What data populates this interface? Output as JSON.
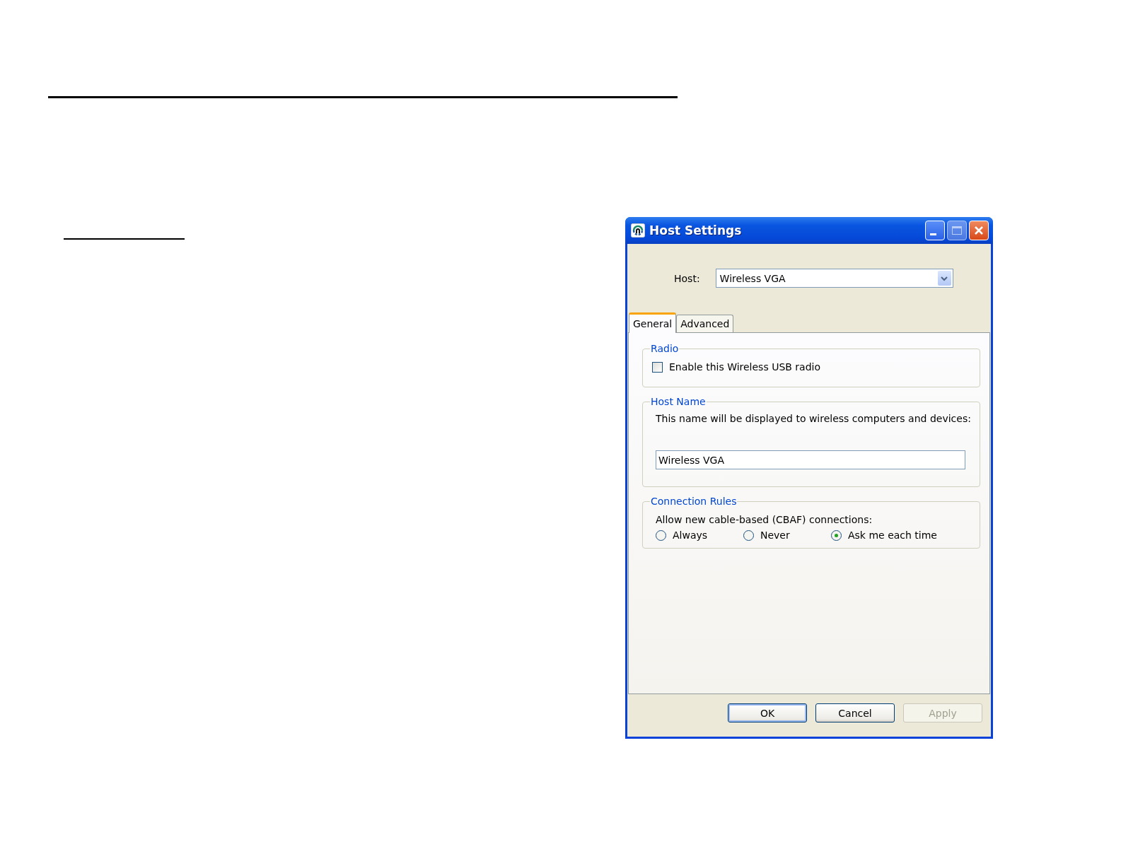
{
  "window": {
    "title": "Host Settings"
  },
  "host": {
    "label": "Host:",
    "value": "Wireless VGA"
  },
  "tabs": [
    {
      "label": "General",
      "selected": true
    },
    {
      "label": "Advanced",
      "selected": false
    }
  ],
  "groups": [
    {
      "kind": "checkbox",
      "title": "Radio",
      "label": "Enable this Wireless USB radio",
      "checked": false
    },
    {
      "kind": "text",
      "title": "Host Name",
      "description": "This name will be displayed to wireless computers and devices:",
      "value": "Wireless VGA"
    },
    {
      "kind": "radio",
      "title": "Connection Rules",
      "description": "Allow new cable-based (CBAF) connections:",
      "options": [
        {
          "label": "Always",
          "selected": false
        },
        {
          "label": "Never",
          "selected": false
        },
        {
          "label": "Ask me each time",
          "selected": true
        }
      ]
    }
  ],
  "buttons": [
    {
      "label": "OK",
      "disabled": false,
      "default": true
    },
    {
      "label": "Cancel",
      "disabled": false,
      "default": false
    },
    {
      "label": "Apply",
      "disabled": true,
      "default": false
    }
  ]
}
